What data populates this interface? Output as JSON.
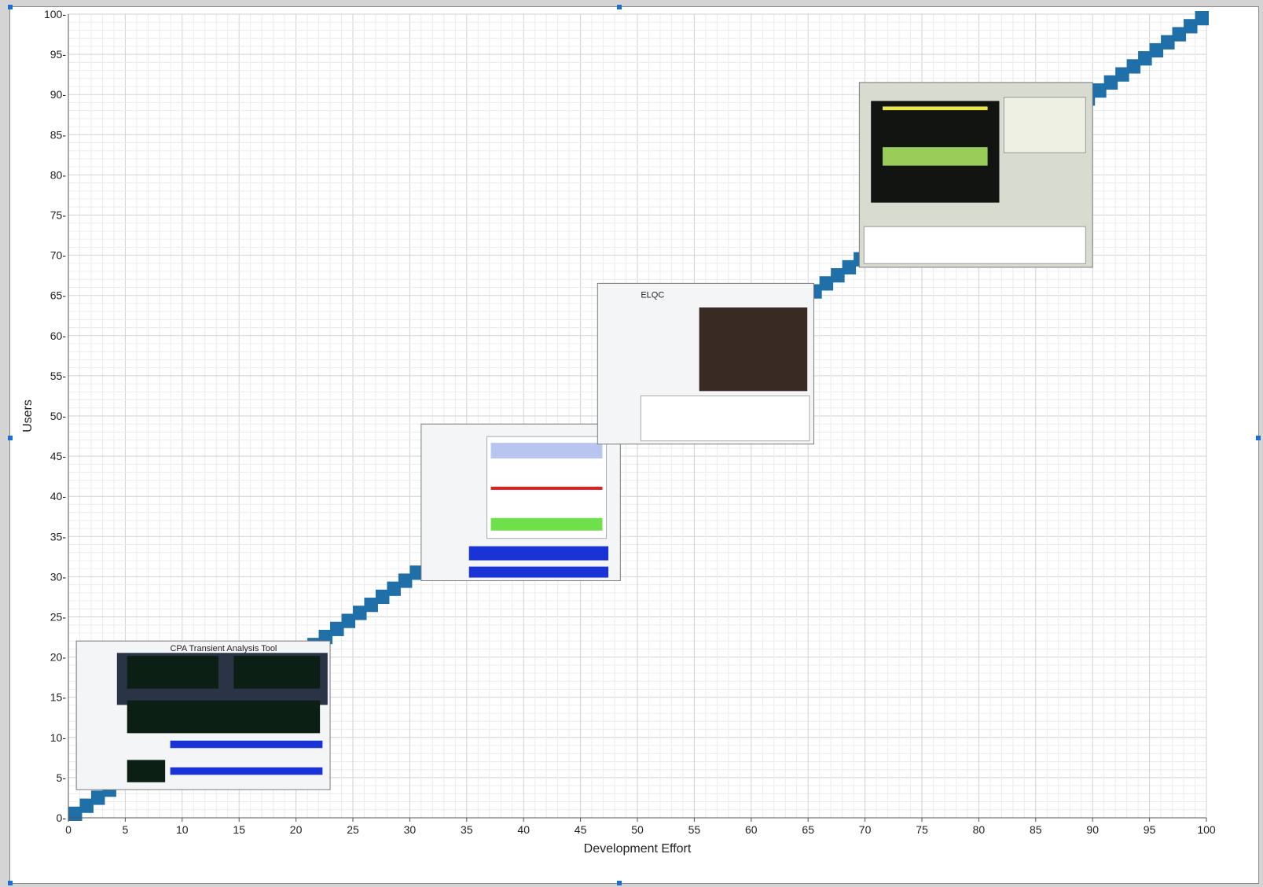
{
  "chart_data": {
    "type": "line",
    "xlabel": "Development Effort",
    "ylabel": "Users",
    "xlim": [
      0,
      100
    ],
    "ylim": [
      0,
      100
    ],
    "xticks": [
      "0",
      "5",
      "10",
      "15",
      "20",
      "25",
      "30",
      "35",
      "40",
      "45",
      "50",
      "55",
      "60",
      "65",
      "70",
      "75",
      "80",
      "85",
      "90",
      "95",
      "100"
    ],
    "yticks": [
      "0-",
      "5-",
      "10-",
      "15-",
      "20-",
      "25-",
      "30-",
      "35-",
      "40-",
      "45-",
      "50-",
      "55-",
      "60-",
      "65-",
      "70-",
      "75-",
      "80-",
      "85-",
      "90-",
      "95-",
      "100-"
    ],
    "grid": true,
    "series": [
      {
        "style": "staircase",
        "color": "#1f6fa8",
        "x": [
          0,
          100
        ],
        "y": [
          0,
          100
        ]
      }
    ],
    "embedded_screenshots": [
      {
        "title": "CPA Transient Analysis Tool",
        "x_range": [
          0.7,
          23
        ],
        "y_range": [
          3.5,
          22
        ]
      },
      {
        "title": "",
        "x_range": [
          31,
          48.5
        ],
        "y_range": [
          29.5,
          49
        ]
      },
      {
        "title": "ELQC",
        "x_range": [
          46.5,
          65.5
        ],
        "y_range": [
          46.5,
          66.5
        ]
      },
      {
        "title": "",
        "x_range": [
          69.5,
          90
        ],
        "y_range": [
          68.5,
          91.5
        ]
      }
    ]
  }
}
